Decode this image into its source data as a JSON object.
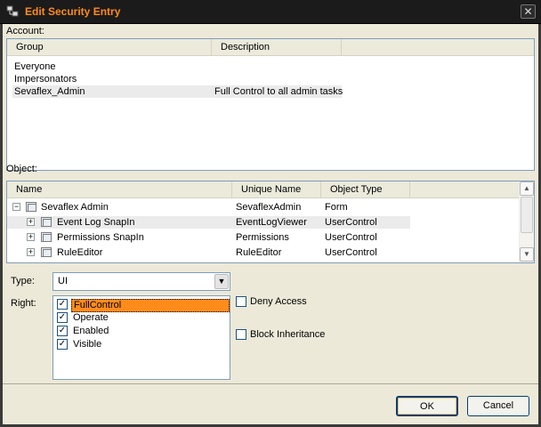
{
  "window": {
    "title": "Edit Security Entry",
    "close_label": "✕"
  },
  "account": {
    "label": "Account:",
    "columns": [
      "Group",
      "Description"
    ],
    "rows": [
      {
        "group": "Everyone",
        "description": ""
      },
      {
        "group": "Impersonators",
        "description": ""
      },
      {
        "group": "Sevaflex_Admin",
        "description": "Full Control to all admin tasks"
      }
    ]
  },
  "object": {
    "label": "Object:",
    "columns": [
      "Name",
      "Unique Name",
      "Object Type"
    ],
    "rows": [
      {
        "name": "Sevaflex Admin",
        "unique": "SevaflexAdmin",
        "type": "Form"
      },
      {
        "name": "Event Log SnapIn",
        "unique": "EventLogViewer",
        "type": "UserControl"
      },
      {
        "name": "Permissions SnapIn",
        "unique": "Permissions",
        "type": "UserControl"
      },
      {
        "name": "RuleEditor",
        "unique": "RuleEditor",
        "type": "UserControl"
      }
    ]
  },
  "type": {
    "label": "Type:",
    "value": "UI"
  },
  "rights": {
    "label": "Right:",
    "items": [
      {
        "label": "FullControl",
        "checked": true
      },
      {
        "label": "Operate",
        "checked": true
      },
      {
        "label": "Enabled",
        "checked": true
      },
      {
        "label": "Visible",
        "checked": true
      }
    ]
  },
  "options": {
    "deny_access": "Deny Access",
    "block_inheritance": "Block Inheritance"
  },
  "buttons": {
    "ok": "OK",
    "cancel": "Cancel"
  },
  "colors": {
    "title_accent": "#ff8a1c",
    "highlight": "#ff8c1a"
  }
}
